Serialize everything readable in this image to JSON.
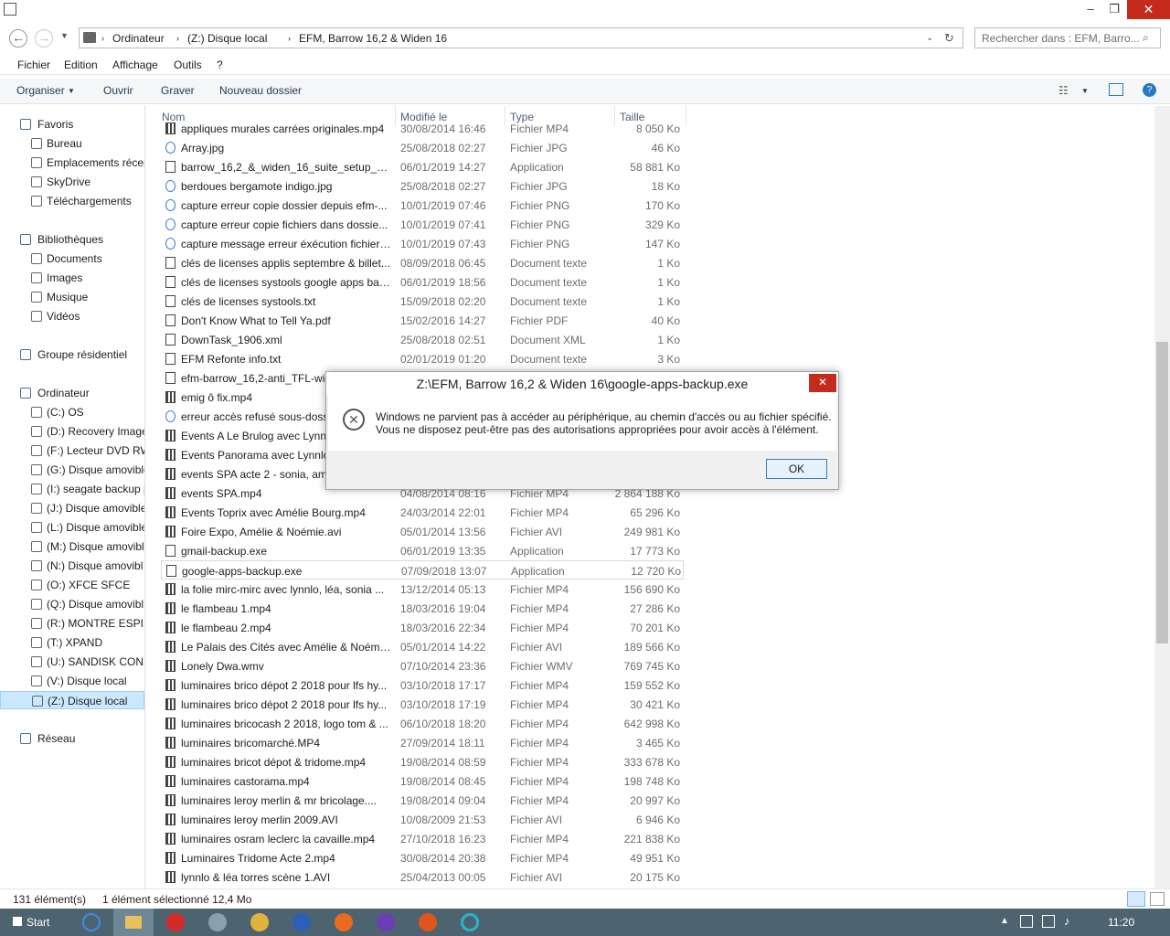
{
  "window": {
    "minimize": "–",
    "maximize": "❐",
    "close": "✕"
  },
  "address": {
    "segments": [
      "Ordinateur",
      "(Z:) Disque local",
      "EFM, Barrow 16,2 & Widen 16"
    ],
    "search_placeholder": "Rechercher dans : EFM, Barro..."
  },
  "menu": [
    "Fichier",
    "Edition",
    "Affichage",
    "Outils",
    "?"
  ],
  "toolbar": {
    "organiser": "Organiser",
    "ouvrir": "Ouvrir",
    "graver": "Graver",
    "nouveau_dossier": "Nouveau dossier"
  },
  "nav": [
    {
      "label": "Favoris",
      "level": 0
    },
    {
      "label": "Bureau",
      "level": 1
    },
    {
      "label": "Emplacements récen",
      "level": 1
    },
    {
      "label": "SkyDrive",
      "level": 1
    },
    {
      "label": "Téléchargements",
      "level": 1
    },
    {
      "label": "Bibliothèques",
      "level": 0
    },
    {
      "label": "Documents",
      "level": 1
    },
    {
      "label": "Images",
      "level": 1
    },
    {
      "label": "Musique",
      "level": 1
    },
    {
      "label": "Vidéos",
      "level": 1
    },
    {
      "label": "Groupe résidentiel",
      "level": 0
    },
    {
      "label": "Ordinateur",
      "level": 0
    },
    {
      "label": "(C:) OS",
      "level": 1
    },
    {
      "label": "(D:) Recovery Image",
      "level": 1
    },
    {
      "label": "(F:) Lecteur DVD RW",
      "level": 1
    },
    {
      "label": "(G:) Disque amovible",
      "level": 1
    },
    {
      "label": "(I:) seagate backup p",
      "level": 1
    },
    {
      "label": "(J:) Disque amovible",
      "level": 1
    },
    {
      "label": "(L:) Disque amovible",
      "level": 1
    },
    {
      "label": "(M:) Disque amovibl",
      "level": 1
    },
    {
      "label": "(N:) Disque amovibl",
      "level": 1
    },
    {
      "label": "(O:) XFCE SFCE",
      "level": 1
    },
    {
      "label": "(Q:) Disque amovibl",
      "level": 1
    },
    {
      "label": "(R:) MONTRE ESPI",
      "level": 1
    },
    {
      "label": "(T:) XPAND",
      "level": 1
    },
    {
      "label": "(U:) SANDISK CON",
      "level": 1
    },
    {
      "label": "(V:) Disque local",
      "level": 1
    },
    {
      "label": "(Z:) Disque local",
      "level": 1
    },
    {
      "label": "Réseau",
      "level": 0
    }
  ],
  "columns": {
    "name": "Nom",
    "modified": "Modifié le",
    "type": "Type",
    "size": "Taille"
  },
  "files": [
    {
      "name": "appliques murales carrées originales.mp4",
      "date": "30/08/2014 16:46",
      "type": "Fichier MP4",
      "size": "8 050 Ko",
      "icon": "vid"
    },
    {
      "name": "Array.jpg",
      "date": "25/08/2018 02:27",
      "type": "Fichier JPG",
      "size": "46 Ko",
      "icon": "img"
    },
    {
      "name": "barrow_16,2_&_widen_16_suite_setup_sib...",
      "date": "06/01/2019 14:27",
      "type": "Application",
      "size": "58 881 Ko",
      "icon": "app"
    },
    {
      "name": "berdoues bergamote indigo.jpg",
      "date": "25/08/2018 02:27",
      "type": "Fichier JPG",
      "size": "18 Ko",
      "icon": "img"
    },
    {
      "name": "capture erreur copie dossier depuis efm-...",
      "date": "10/01/2019 07:46",
      "type": "Fichier PNG",
      "size": "170 Ko",
      "icon": "img"
    },
    {
      "name": "capture erreur copie fichiers dans  dossie...",
      "date": "10/01/2019 07:41",
      "type": "Fichier PNG",
      "size": "329 Ko",
      "icon": "img"
    },
    {
      "name": "capture message erreur éxécution fichier ...",
      "date": "10/01/2019 07:43",
      "type": "Fichier PNG",
      "size": "147 Ko",
      "icon": "img"
    },
    {
      "name": "clés de licenses applis septembre & billet...",
      "date": "08/09/2018 06:45",
      "type": "Document texte",
      "size": "1 Ko",
      "icon": "doc"
    },
    {
      "name": "clés de licenses systools google apps bac...",
      "date": "06/01/2019 18:56",
      "type": "Document texte",
      "size": "1 Ko",
      "icon": "doc"
    },
    {
      "name": "clés de licenses systools.txt",
      "date": "15/09/2018 02:20",
      "type": "Document texte",
      "size": "1 Ko",
      "icon": "doc"
    },
    {
      "name": "Don't Know What to Tell Ya.pdf",
      "date": "15/02/2016 14:27",
      "type": "Fichier PDF",
      "size": "40 Ko",
      "icon": "doc"
    },
    {
      "name": "DownTask_1906.xml",
      "date": "25/08/2018 02:51",
      "type": "Document XML",
      "size": "1 Ko",
      "icon": "doc"
    },
    {
      "name": "EFM Refonte info.txt",
      "date": "02/01/2019 01:20",
      "type": "Document texte",
      "size": "3 Ko",
      "icon": "doc"
    },
    {
      "name": "efm-barrow_16,2-anti_TFL-wid",
      "date": "",
      "type": "",
      "size": "",
      "icon": "app"
    },
    {
      "name": "emig ô fix.mp4",
      "date": "",
      "type": "",
      "size": "",
      "icon": "vid"
    },
    {
      "name": "erreur accès refusé sous-dossi",
      "date": "",
      "type": "",
      "size": "",
      "icon": "img"
    },
    {
      "name": "Events A Le Brulog avec Lynnl",
      "date": "",
      "type": "",
      "size": "",
      "icon": "vid"
    },
    {
      "name": "Events Panorama avec Lynnlo,",
      "date": "",
      "type": "",
      "size": "",
      "icon": "vid"
    },
    {
      "name": "events SPA acte 2 - sonia, amé",
      "date": "",
      "type": "",
      "size": "",
      "icon": "vid"
    },
    {
      "name": "events SPA.mp4",
      "date": "04/08/2014 08:16",
      "type": "Fichier MP4",
      "size": "2 864 188 Ko",
      "icon": "vid"
    },
    {
      "name": "Events Toprix avec Amélie Bourg.mp4",
      "date": "24/03/2014 22:01",
      "type": "Fichier MP4",
      "size": "65 296 Ko",
      "icon": "vid"
    },
    {
      "name": "Foire Expo, Amélie & Noémie.avi",
      "date": "05/01/2014 13:56",
      "type": "Fichier AVI",
      "size": "249 981 Ko",
      "icon": "vid"
    },
    {
      "name": "gmail-backup.exe",
      "date": "06/01/2019 13:35",
      "type": "Application",
      "size": "17 773 Ko",
      "icon": "app"
    },
    {
      "name": "google-apps-backup.exe",
      "date": "07/09/2018 13:07",
      "type": "Application",
      "size": "12 720 Ko",
      "icon": "app",
      "selected": true
    },
    {
      "name": "la folie mirc-mirc avec lynnlo, léa, sonia ...",
      "date": "13/12/2014 05:13",
      "type": "Fichier MP4",
      "size": "156 690 Ko",
      "icon": "vid"
    },
    {
      "name": "le flambeau 1.mp4",
      "date": "18/03/2016 19:04",
      "type": "Fichier MP4",
      "size": "27 286 Ko",
      "icon": "vid"
    },
    {
      "name": "le flambeau 2.mp4",
      "date": "18/03/2016 22:34",
      "type": "Fichier MP4",
      "size": "70 201 Ko",
      "icon": "vid"
    },
    {
      "name": "Le Palais des Cités avec Amélie & Noémi...",
      "date": "05/01/2014 14:22",
      "type": "Fichier AVI",
      "size": "189 566 Ko",
      "icon": "vid"
    },
    {
      "name": "Lonely Dwa.wmv",
      "date": "07/10/2014 23:36",
      "type": "Fichier WMV",
      "size": "769 745 Ko",
      "icon": "vid"
    },
    {
      "name": "luminaires brico dépot 2 2018 pour lfs hy...",
      "date": "03/10/2018 17:17",
      "type": "Fichier MP4",
      "size": "159 552 Ko",
      "icon": "vid"
    },
    {
      "name": "luminaires brico dépot 2 2018 pour lfs hy...",
      "date": "03/10/2018 17:19",
      "type": "Fichier MP4",
      "size": "30 421 Ko",
      "icon": "vid"
    },
    {
      "name": "luminaires bricocash 2 2018, logo tom & ...",
      "date": "06/10/2018 18:20",
      "type": "Fichier MP4",
      "size": "642 998 Ko",
      "icon": "vid"
    },
    {
      "name": "luminaires bricomarché.MP4",
      "date": "27/09/2014 18:11",
      "type": "Fichier MP4",
      "size": "3 465 Ko",
      "icon": "vid"
    },
    {
      "name": "luminaires bricot dépot & tridome.mp4",
      "date": "19/08/2014 08:59",
      "type": "Fichier MP4",
      "size": "333 678 Ko",
      "icon": "vid"
    },
    {
      "name": "luminaires castorama.mp4",
      "date": "19/08/2014 08:45",
      "type": "Fichier MP4",
      "size": "198 748 Ko",
      "icon": "vid"
    },
    {
      "name": "luminaires leroy merlin & mr bricolage....",
      "date": "19/08/2014 09:04",
      "type": "Fichier MP4",
      "size": "20 997 Ko",
      "icon": "vid"
    },
    {
      "name": "luminaires leroy merlin 2009.AVI",
      "date": "10/08/2009 21:53",
      "type": "Fichier AVI",
      "size": "6 946 Ko",
      "icon": "vid"
    },
    {
      "name": "luminaires osram leclerc la cavaille.mp4",
      "date": "27/10/2018 16:23",
      "type": "Fichier MP4",
      "size": "221 838 Ko",
      "icon": "vid"
    },
    {
      "name": "Luminaires Tridome Acte 2.mp4",
      "date": "30/08/2014 20:38",
      "type": "Fichier MP4",
      "size": "49 951 Ko",
      "icon": "vid"
    },
    {
      "name": "lynnlo & léa torres scène 1.AVI",
      "date": "25/04/2013 00:05",
      "type": "Fichier AVI",
      "size": "20 175 Ko",
      "icon": "vid"
    }
  ],
  "status": {
    "count": "131 élément(s)",
    "selection": "1 élément sélectionné  12,4 Mo"
  },
  "dialog": {
    "title": "Z:\\EFM, Barrow 16,2 & Widen 16\\google-apps-backup.exe",
    "line1": "Windows ne parvient pas à accéder au périphérique, au chemin d'accès ou au fichier spécifié.",
    "line2": "Vous ne disposez peut-être pas des autorisations appropriées pour avoir accès à l'élément.",
    "ok": "OK",
    "close": "✕"
  },
  "taskbar": {
    "start": "Start",
    "clock": "11:20"
  }
}
